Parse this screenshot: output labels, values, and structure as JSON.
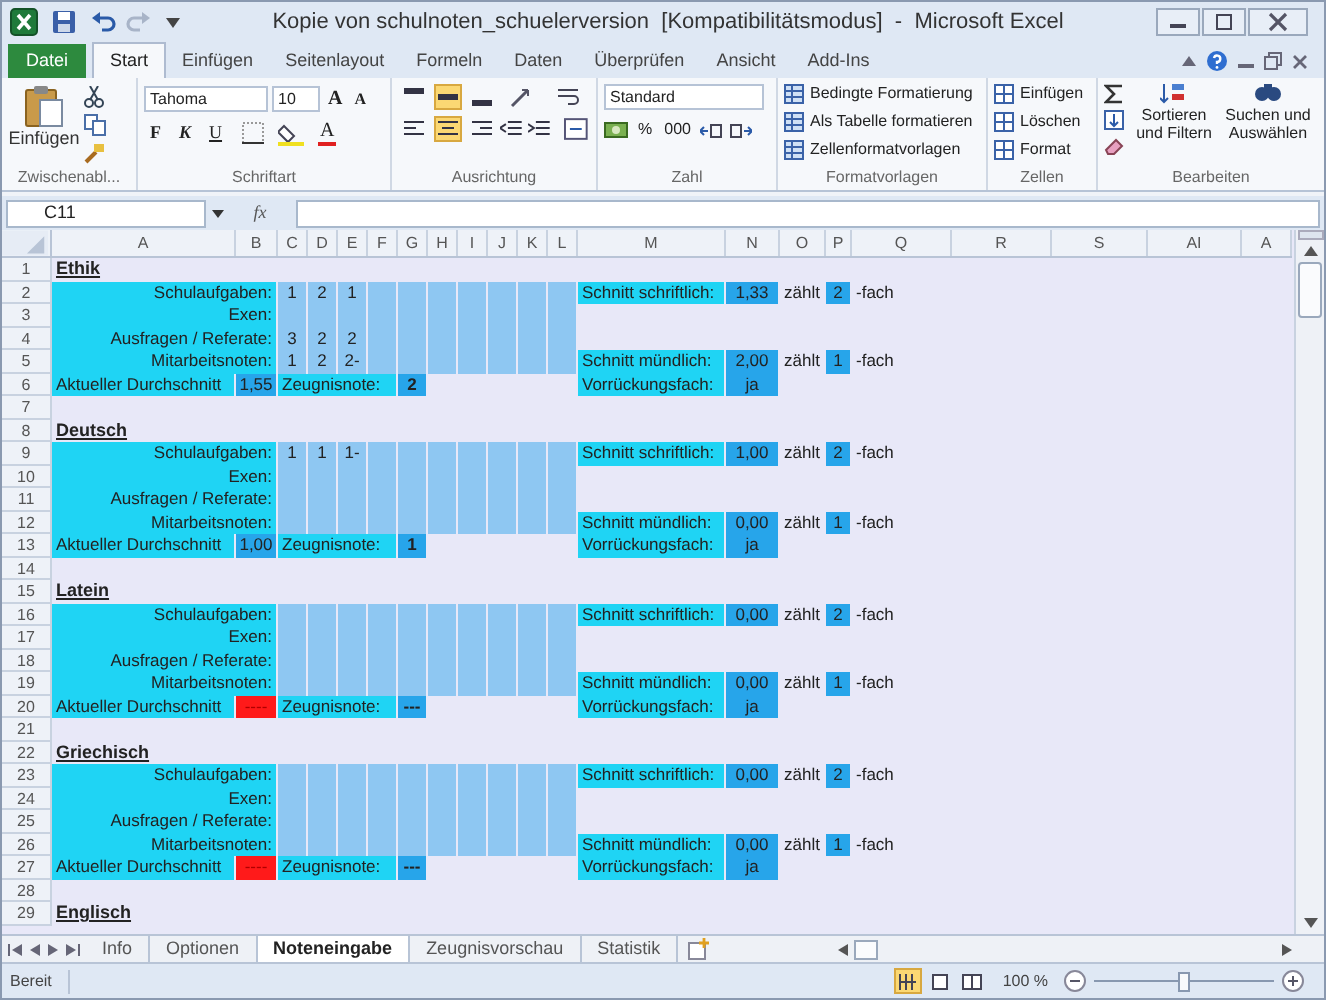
{
  "window": {
    "title": "Kopie von schulnoten_schuelerversion  [Kompatibilitätsmodus]  -  Microsoft Excel"
  },
  "ribbon_tabs": [
    {
      "label": "Datei",
      "kind": "file"
    },
    {
      "label": "Start",
      "kind": "tab",
      "selected": true
    },
    {
      "label": "Einfügen",
      "kind": "tab",
      "selected": false
    },
    {
      "label": "Seitenlayout",
      "kind": "tab",
      "selected": false
    },
    {
      "label": "Formeln",
      "kind": "tab",
      "selected": false
    },
    {
      "label": "Daten",
      "kind": "tab",
      "selected": false
    },
    {
      "label": "Überprüfen",
      "kind": "tab",
      "selected": false
    },
    {
      "label": "Ansicht",
      "kind": "tab",
      "selected": false
    },
    {
      "label": "Add-Ins",
      "kind": "tab",
      "selected": false
    }
  ],
  "ribbon": {
    "clipboard": {
      "paste": "Einfügen",
      "label": "Zwischenabl..."
    },
    "font": {
      "family": "Tahoma",
      "size": "10",
      "grow": "A",
      "shrink": "A",
      "bold": "F",
      "italic": "K",
      "underline": "U",
      "font_color_button": "A",
      "label": "Schriftart"
    },
    "alignment": {
      "label": "Ausrichtung",
      "vertical": [
        {
          "selected": false
        },
        {
          "selected": true
        },
        {
          "selected": false
        }
      ],
      "horizontal": [
        {
          "selected": false
        },
        {
          "selected": true
        },
        {
          "selected": false
        }
      ]
    },
    "number": {
      "format": "Standard",
      "percent": "%",
      "thousands": "000",
      "label": "Zahl"
    },
    "styles": {
      "items": [
        "Bedingte Formatierung",
        "Als Tabelle formatieren",
        "Zellenformatvorlagen"
      ],
      "label": "Formatvorlagen"
    },
    "cells": {
      "items": [
        "Einfügen",
        "Löschen",
        "Format"
      ],
      "label": "Zellen"
    },
    "editing": {
      "items": [
        "Sortieren und Filtern",
        "Suchen und Auswählen"
      ],
      "label": "Bearbeiten"
    }
  },
  "formula_bar": {
    "name_box": "C11",
    "function_label": "fx"
  },
  "sheet": {
    "columns": [
      "A",
      "B",
      "C",
      "D",
      "E",
      "F",
      "G",
      "H",
      "I",
      "J",
      "K",
      "L",
      "M",
      "N",
      "O",
      "P",
      "Q",
      "R",
      "S",
      "AI",
      "A"
    ],
    "rows": [
      {
        "number": "1",
        "kind": "title",
        "text": "Ethik"
      },
      {
        "number": "2",
        "kind": "grades",
        "label": "Schulaufgaben:",
        "grades": [
          "1",
          "2",
          "1"
        ],
        "right": {
          "label": "Schnitt schriftlich:",
          "value": "1,33",
          "weight_label": "zählt",
          "weight": "2",
          "suffix": "-fach"
        }
      },
      {
        "number": "3",
        "kind": "grades",
        "label": "Exen:",
        "grades": []
      },
      {
        "number": "4",
        "kind": "grades",
        "label": "Ausfragen / Referate:",
        "grades": [
          "3",
          "2",
          "2"
        ]
      },
      {
        "number": "5",
        "kind": "grades",
        "label": "Mitarbeitsnoten:",
        "grades": [
          "1",
          "2",
          "2-"
        ],
        "right": {
          "label": "Schnitt mündlich:",
          "value": "2,00",
          "weight_label": "zählt",
          "weight": "1",
          "suffix": "-fach"
        }
      },
      {
        "number": "6",
        "kind": "summary",
        "label": "Aktueller Durchschnitt",
        "average": "1,55",
        "average_error": false,
        "grade_label": "Zeugnisnote:",
        "grade": "2",
        "right": {
          "label": "Vorrückungsfach:",
          "value": "ja"
        }
      },
      {
        "number": "7",
        "kind": "blank"
      },
      {
        "number": "8",
        "kind": "title",
        "text": "Deutsch"
      },
      {
        "number": "9",
        "kind": "grades",
        "label": "Schulaufgaben:",
        "grades": [
          "1",
          "1",
          "1-"
        ],
        "right": {
          "label": "Schnitt schriftlich:",
          "value": "1,00",
          "weight_label": "zählt",
          "weight": "2",
          "suffix": "-fach"
        }
      },
      {
        "number": "10",
        "kind": "grades",
        "label": "Exen:",
        "grades": []
      },
      {
        "number": "11",
        "kind": "grades",
        "label": "Ausfragen / Referate:",
        "grades": []
      },
      {
        "number": "12",
        "kind": "grades",
        "label": "Mitarbeitsnoten:",
        "grades": [],
        "right": {
          "label": "Schnitt mündlich:",
          "value": "0,00",
          "weight_label": "zählt",
          "weight": "1",
          "suffix": "-fach"
        }
      },
      {
        "number": "13",
        "kind": "summary",
        "label": "Aktueller Durchschnitt",
        "average": "1,00",
        "average_error": false,
        "grade_label": "Zeugnisnote:",
        "grade": "1",
        "right": {
          "label": "Vorrückungsfach:",
          "value": "ja"
        }
      },
      {
        "number": "14",
        "kind": "blank"
      },
      {
        "number": "15",
        "kind": "title",
        "text": "Latein"
      },
      {
        "number": "16",
        "kind": "grades",
        "label": "Schulaufgaben:",
        "grades": [],
        "right": {
          "label": "Schnitt schriftlich:",
          "value": "0,00",
          "weight_label": "zählt",
          "weight": "2",
          "suffix": "-fach"
        }
      },
      {
        "number": "17",
        "kind": "grades",
        "label": "Exen:",
        "grades": []
      },
      {
        "number": "18",
        "kind": "grades",
        "label": "Ausfragen / Referate:",
        "grades": []
      },
      {
        "number": "19",
        "kind": "grades",
        "label": "Mitarbeitsnoten:",
        "grades": [],
        "right": {
          "label": "Schnitt mündlich:",
          "value": "0,00",
          "weight_label": "zählt",
          "weight": "1",
          "suffix": "-fach"
        }
      },
      {
        "number": "20",
        "kind": "summary",
        "label": "Aktueller Durchschnitt",
        "average": "----",
        "average_error": true,
        "grade_label": "Zeugnisnote:",
        "grade": "---",
        "right": {
          "label": "Vorrückungsfach:",
          "value": "ja"
        }
      },
      {
        "number": "21",
        "kind": "blank"
      },
      {
        "number": "22",
        "kind": "title",
        "text": "Griechisch"
      },
      {
        "number": "23",
        "kind": "grades",
        "label": "Schulaufgaben:",
        "grades": [],
        "right": {
          "label": "Schnitt schriftlich:",
          "value": "0,00",
          "weight_label": "zählt",
          "weight": "2",
          "suffix": "-fach"
        }
      },
      {
        "number": "24",
        "kind": "grades",
        "label": "Exen:",
        "grades": []
      },
      {
        "number": "25",
        "kind": "grades",
        "label": "Ausfragen / Referate:",
        "grades": []
      },
      {
        "number": "26",
        "kind": "grades",
        "label": "Mitarbeitsnoten:",
        "grades": [],
        "right": {
          "label": "Schnitt mündlich:",
          "value": "0,00",
          "weight_label": "zählt",
          "weight": "1",
          "suffix": "-fach"
        }
      },
      {
        "number": "27",
        "kind": "summary",
        "label": "Aktueller Durchschnitt",
        "average": "----",
        "average_error": true,
        "grade_label": "Zeugnisnote:",
        "grade": "---",
        "right": {
          "label": "Vorrückungsfach:",
          "value": "ja"
        }
      },
      {
        "number": "28",
        "kind": "blank"
      },
      {
        "number": "29",
        "kind": "title",
        "text": "Englisch"
      }
    ]
  },
  "sheet_tabs": [
    {
      "label": "Info",
      "selected": false
    },
    {
      "label": "Optionen",
      "selected": false
    },
    {
      "label": "Noteneingabe",
      "selected": true
    },
    {
      "label": "Zeugnisvorschau",
      "selected": false
    },
    {
      "label": "Statistik",
      "selected": false
    }
  ],
  "status_bar": {
    "status": "Bereit",
    "view_buttons": [
      {
        "selected": true
      },
      {
        "selected": false
      },
      {
        "selected": false
      }
    ],
    "zoom": "100 %",
    "zoom_slider": {
      "level": 0.5
    }
  }
}
